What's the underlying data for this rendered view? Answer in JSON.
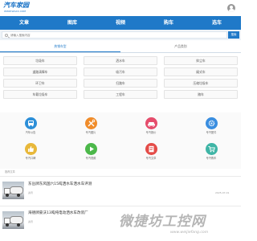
{
  "header": {
    "logo_main": "汽车家园",
    "logo_sub": "WWW.WGCC.COM"
  },
  "nav": [
    {
      "label": "文章"
    },
    {
      "label": "图库"
    },
    {
      "label": "视频"
    },
    {
      "label": "购车"
    },
    {
      "label": "选车"
    }
  ],
  "search": {
    "placeholder": "请输入搜索内容",
    "button_label": "搜索"
  },
  "tabs": [
    {
      "label": "热销车型",
      "active": true
    },
    {
      "label": "产品类别",
      "active": false
    }
  ],
  "vehicle_types": [
    [
      "垃圾车",
      "洒水车",
      "抑尘车"
    ],
    [
      "道路清障车",
      "吸污车",
      "厢式车"
    ],
    [
      "环卫车",
      "扫路车",
      "压缩垃圾车"
    ],
    [
      "车载垃圾车",
      "工程车",
      "随车"
    ]
  ],
  "shortcuts": [
    {
      "label": "汽车公告",
      "icon": "bus-icon",
      "color": "#2d8fd8"
    },
    {
      "label": "专汽图片",
      "icon": "tools-icon",
      "color": "#f08c2a"
    },
    {
      "label": "专汽报价",
      "icon": "car-icon",
      "color": "#e54d6c"
    },
    {
      "label": "专汽配件",
      "icon": "gear-icon",
      "color": "#3a8ee0"
    },
    {
      "label": "专汽口碑",
      "icon": "thumbs-icon",
      "color": "#e8b83a"
    },
    {
      "label": "专汽视频",
      "icon": "play-icon",
      "color": "#4cb84a"
    },
    {
      "label": "专汽文章",
      "icon": "document-icon",
      "color": "#e44c48"
    },
    {
      "label": "专汽购车",
      "icon": "cart-icon",
      "color": "#3fb5a6"
    }
  ],
  "more_text": "推荐文章",
  "articles": [
    {
      "title": "东岳牌东风国六15吨洒水车洒水车评测",
      "meta": "资讯",
      "date": "2025-07-01"
    },
    {
      "title": "海德牌豪沃13吨纯电动洒水车改装厂",
      "meta": "资讯",
      "date": ""
    }
  ],
  "watermark": {
    "main": "微捷坊工控网",
    "sub": "www.weijiefang.com"
  }
}
